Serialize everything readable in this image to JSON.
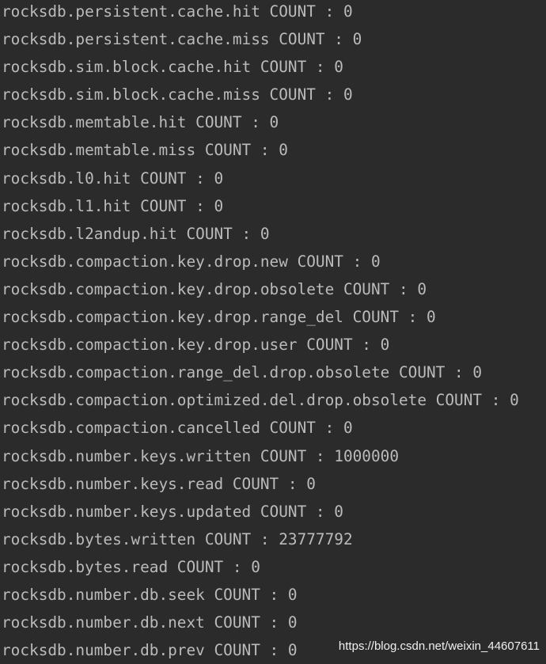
{
  "console": {
    "lines": [
      "rocksdb.persistent.cache.hit COUNT : 0",
      "rocksdb.persistent.cache.miss COUNT : 0",
      "rocksdb.sim.block.cache.hit COUNT : 0",
      "rocksdb.sim.block.cache.miss COUNT : 0",
      "rocksdb.memtable.hit COUNT : 0",
      "rocksdb.memtable.miss COUNT : 0",
      "rocksdb.l0.hit COUNT : 0",
      "rocksdb.l1.hit COUNT : 0",
      "rocksdb.l2andup.hit COUNT : 0",
      "rocksdb.compaction.key.drop.new COUNT : 0",
      "rocksdb.compaction.key.drop.obsolete COUNT : 0",
      "rocksdb.compaction.key.drop.range_del COUNT : 0",
      "rocksdb.compaction.key.drop.user COUNT : 0",
      "rocksdb.compaction.range_del.drop.obsolete COUNT : 0",
      "rocksdb.compaction.optimized.del.drop.obsolete COUNT : 0",
      "rocksdb.compaction.cancelled COUNT : 0",
      "rocksdb.number.keys.written COUNT : 1000000",
      "rocksdb.number.keys.read COUNT : 0",
      "rocksdb.number.keys.updated COUNT : 0",
      "rocksdb.bytes.written COUNT : 23777792",
      "rocksdb.bytes.read COUNT : 0",
      "rocksdb.number.db.seek COUNT : 0",
      "rocksdb.number.db.next COUNT : 0",
      "rocksdb.number.db.prev COUNT : 0"
    ]
  },
  "watermark": "https://blog.csdn.net/weixin_44607611",
  "colors": {
    "background": "#2b2b2b",
    "text": "#bbbbbb"
  }
}
